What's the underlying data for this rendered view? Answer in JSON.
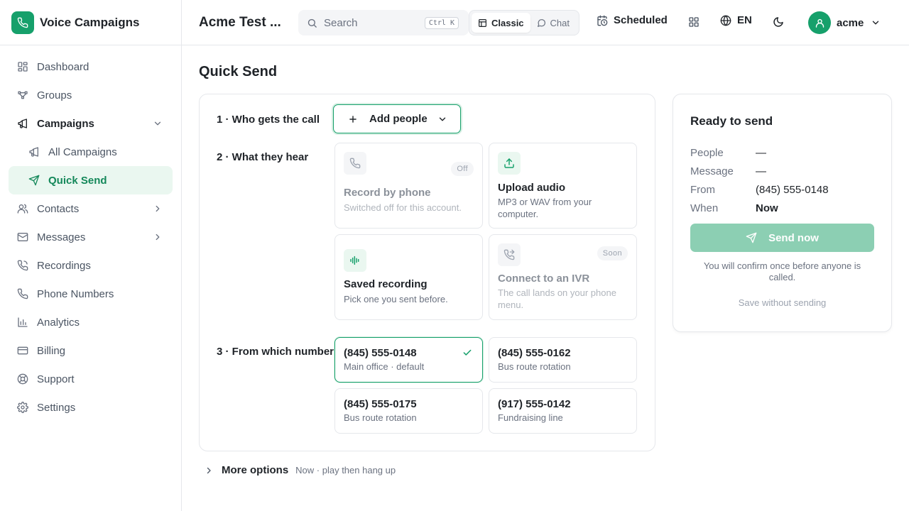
{
  "brand": {
    "name": "Voice Campaigns",
    "logo_icon": "phone-icon",
    "color": "#16a06b"
  },
  "sidebar": {
    "items": [
      {
        "label": "Dashboard",
        "icon": "dashboard-icon"
      },
      {
        "label": "Groups",
        "icon": "groups-icon"
      },
      {
        "label": "Campaigns",
        "icon": "megaphone-icon",
        "expanded": true,
        "children": [
          {
            "label": "All Campaigns",
            "icon": "megaphone-icon"
          },
          {
            "label": "Quick Send",
            "icon": "send-icon",
            "active": true
          }
        ]
      },
      {
        "label": "Contacts",
        "icon": "contacts-icon",
        "has_children": true
      },
      {
        "label": "Messages",
        "icon": "mail-icon",
        "has_children": true
      },
      {
        "label": "Recordings",
        "icon": "recordings-icon"
      },
      {
        "label": "Phone Numbers",
        "icon": "phone-icon"
      },
      {
        "label": "Analytics",
        "icon": "analytics-icon"
      },
      {
        "label": "Billing",
        "icon": "billing-icon"
      },
      {
        "label": "Support",
        "icon": "support-icon"
      },
      {
        "label": "Settings",
        "icon": "gear-icon"
      }
    ]
  },
  "topbar": {
    "org_name": "Acme Test ...",
    "search": {
      "placeholder": "Search",
      "shortcut": "Ctrl K"
    },
    "view_toggle": {
      "classic": "Classic",
      "chat": "Chat",
      "selected": "Classic"
    },
    "scheduled": "Scheduled",
    "language": "EN",
    "user": "acme"
  },
  "page": {
    "title": "Quick Send",
    "step1": {
      "label": "1 · Who gets the call",
      "button": "Add people"
    },
    "step2": {
      "label": "2 · What they hear",
      "options": [
        {
          "title": "Record by phone",
          "subtitle": "Switched off for this account.",
          "badge": "Off",
          "icon": "phone-icon",
          "disabled": true
        },
        {
          "title": "Upload audio",
          "subtitle": "MP3 or WAV from your computer.",
          "icon": "upload-icon",
          "disabled": false
        },
        {
          "title": "Saved recording",
          "subtitle": "Pick one you sent before.",
          "icon": "waveform-icon",
          "disabled": false
        },
        {
          "title": "Connect to an IVR",
          "subtitle": "The call lands on your phone menu.",
          "badge": "Soon",
          "icon": "phone-forward-icon",
          "disabled": true
        }
      ]
    },
    "step3": {
      "label": "3 · From which number",
      "numbers": [
        {
          "number": "(845) 555-0148",
          "desc": "Main office · default",
          "selected": true
        },
        {
          "number": "(845) 555-0162",
          "desc": "Bus route rotation",
          "selected": false
        },
        {
          "number": "(845) 555-0175",
          "desc": "Bus route rotation",
          "selected": false
        },
        {
          "number": "(917) 555-0142",
          "desc": "Fundraising line",
          "selected": false
        }
      ]
    },
    "more_options": {
      "label": "More options",
      "summary": "Now · play then hang up"
    }
  },
  "summary": {
    "title": "Ready to send",
    "rows": [
      {
        "key": "People",
        "value": "—"
      },
      {
        "key": "Message",
        "value": "—"
      },
      {
        "key": "From",
        "value": "(845) 555-0148"
      },
      {
        "key": "When",
        "value": "Now"
      }
    ],
    "send_button": "Send now",
    "confirm_note": "You will confirm once before anyone is called.",
    "save_link": "Save without sending"
  },
  "colors": {
    "accent": "#16a06b",
    "accent_soft": "#eaf7f0",
    "send_disabled": "#8ccfb3"
  }
}
